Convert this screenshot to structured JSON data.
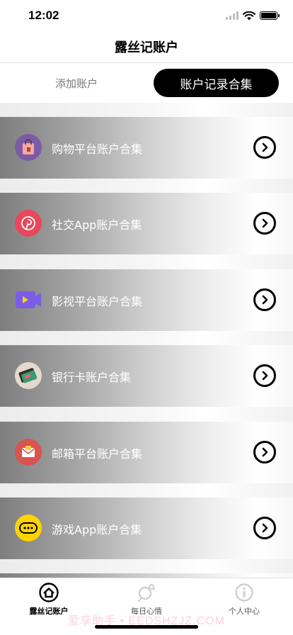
{
  "status_bar": {
    "time": "12:02"
  },
  "nav": {
    "title": "露丝记账户"
  },
  "segments": {
    "add_account": "添加账户",
    "records": "账户记录合集"
  },
  "cards": [
    {
      "label": "购物平台账户合集",
      "icon": "shopping-bag-icon",
      "color": "#7b5ba8"
    },
    {
      "label": "社交App账户合集",
      "icon": "pinterest-icon",
      "color": "#e8485a"
    },
    {
      "label": "影视平台账户合集",
      "icon": "video-icon",
      "color": "#7a5ce8"
    },
    {
      "label": "银行卡账户合集",
      "icon": "bank-card-icon",
      "color": "#3b9b6e"
    },
    {
      "label": "邮箱平台账户合集",
      "icon": "mail-icon",
      "color": "#d9534f"
    },
    {
      "label": "游戏App账户合集",
      "icon": "gamepad-icon",
      "color": "#ffd400"
    }
  ],
  "tabbar": {
    "home": "露丝记账户",
    "mood": "每日心情",
    "profile": "个人中心"
  },
  "watermark": "爱享助手 • EEDSHZJZ.COM"
}
